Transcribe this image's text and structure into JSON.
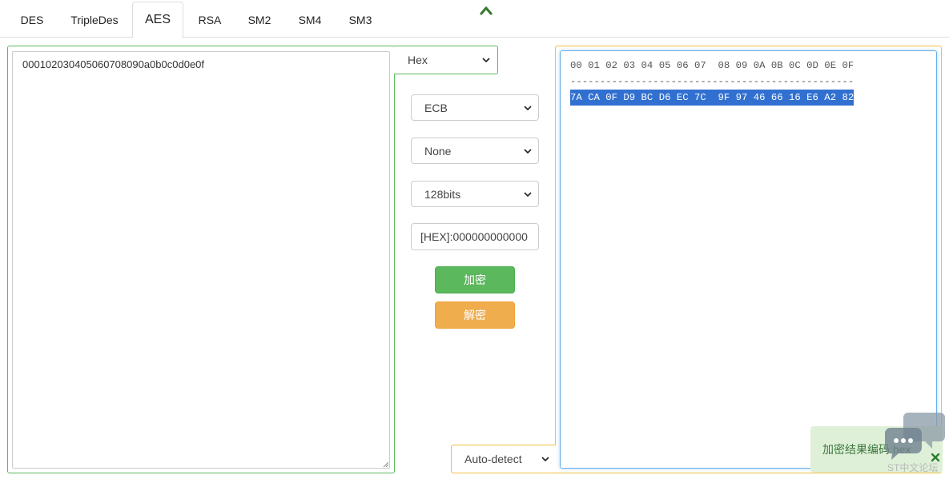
{
  "tabs": [
    {
      "label": "DES"
    },
    {
      "label": "TripleDes"
    },
    {
      "label": "AES"
    },
    {
      "label": "RSA"
    },
    {
      "label": "SM2"
    },
    {
      "label": "SM4"
    },
    {
      "label": "SM3"
    }
  ],
  "active_tab": "AES",
  "plaintext": {
    "value": "000102030405060708090a0b0c0d0e0f",
    "encoding": "Hex"
  },
  "options": {
    "mode": "ECB",
    "padding": "None",
    "key_size": "128bits",
    "key_value": "[HEX]:000000000000"
  },
  "buttons": {
    "encrypt": "加密",
    "decrypt": "解密"
  },
  "ciphertext": {
    "header": "00 01 02 03 04 05 06 07  08 09 0A 0B 0C 0D 0E 0F",
    "divider": "------------------------------------------------",
    "row": "7A CA 0F D9 BC D6 EC 7C  9F 97 46 66 16 E6 A2 82",
    "encoding": "Auto-detect"
  },
  "toast": {
    "message": "加密结果编码:hex"
  },
  "chat_widget": {
    "caption": "ST中文论坛"
  },
  "colors": {
    "green": "#5cb85c",
    "orange": "#f0ad4e",
    "yellow_border": "#f0c040",
    "selection": "#3170d0",
    "toast_bg": "#dff0d8"
  }
}
